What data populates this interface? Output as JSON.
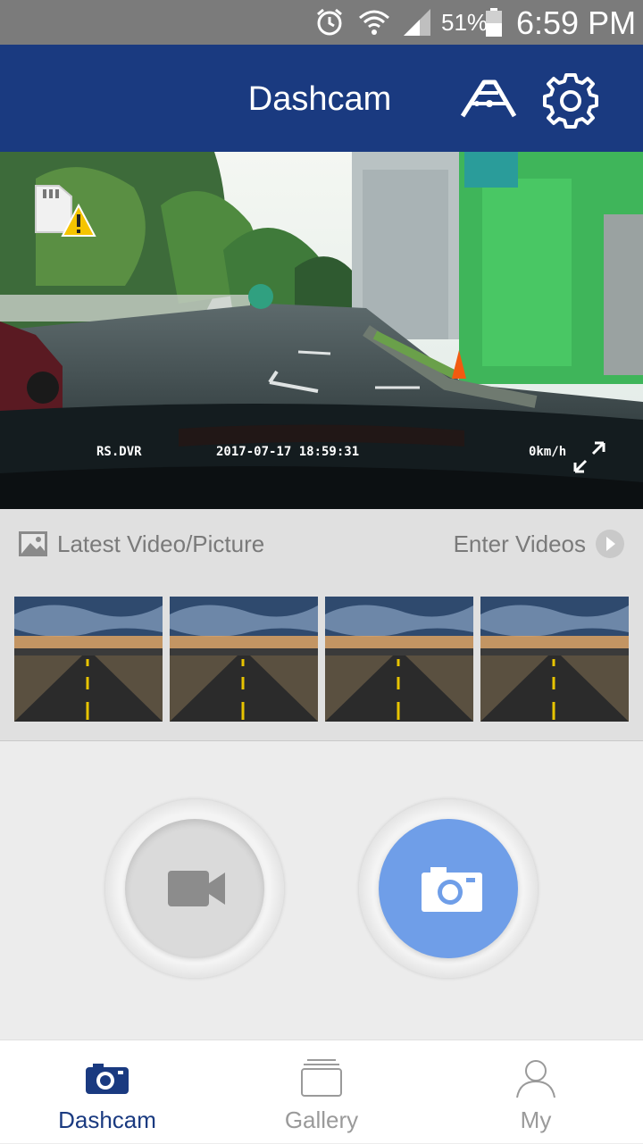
{
  "status_bar": {
    "battery": "51%",
    "time": "6:59 PM",
    "icons": [
      "alarm-icon",
      "wifi-icon",
      "signal-icon",
      "battery-icon"
    ]
  },
  "app_bar": {
    "title": "Dashcam",
    "actions": [
      "wifi-connect-icon",
      "settings-gear-icon"
    ]
  },
  "live_view": {
    "osd_left": "RS.DVR",
    "osd_datetime": "2017-07-17 18:59:31",
    "osd_speed": "0km/h",
    "icons": [
      "sd-card-warning-icon",
      "fullscreen-icon"
    ]
  },
  "latest": {
    "label": "Latest Video/Picture",
    "enter_label": "Enter Videos",
    "thumbnails": 4
  },
  "controls": {
    "record_icon": "video-camera-icon",
    "snapshot_icon": "camera-icon",
    "snapshot_color": "#6f9ee8"
  },
  "bottom_nav": {
    "items": [
      {
        "label": "Dashcam",
        "icon": "camera-icon",
        "active": true
      },
      {
        "label": "Gallery",
        "icon": "gallery-stack-icon",
        "active": false
      },
      {
        "label": "My",
        "icon": "person-icon",
        "active": false
      }
    ],
    "active_color": "#1a3a80"
  },
  "colors": {
    "app_bar": "#1a3a80",
    "status_bar": "#7b7b7b"
  }
}
